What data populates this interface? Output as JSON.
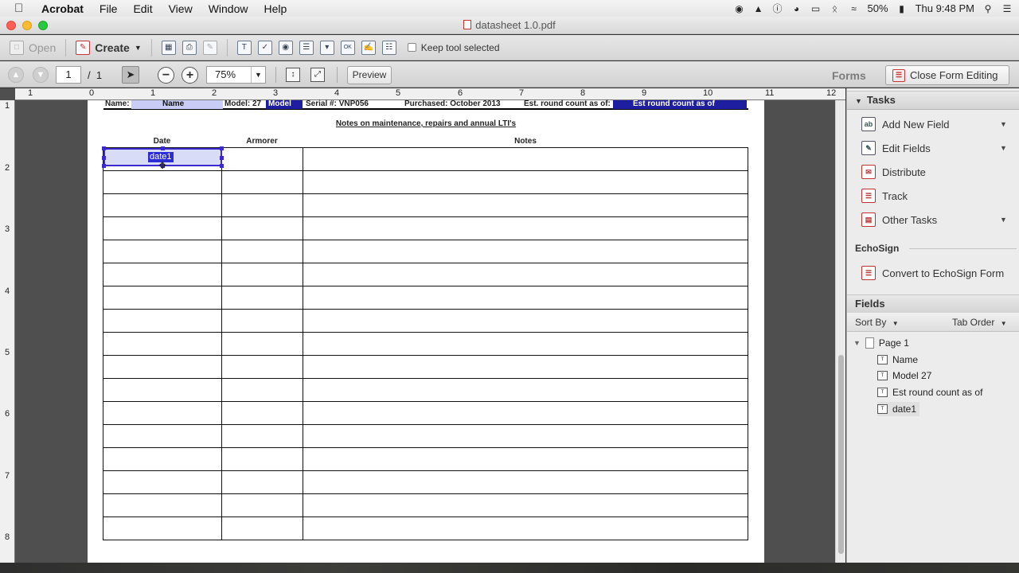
{
  "menubar": {
    "app_name": "Acrobat",
    "items": [
      "File",
      "Edit",
      "View",
      "Window",
      "Help"
    ],
    "battery": "50%",
    "clock": "Thu 9:48 PM"
  },
  "window": {
    "title": "datasheet 1.0.pdf"
  },
  "toolbar1": {
    "open_label": "Open",
    "create_label": "Create",
    "keep_tool_label": "Keep tool selected"
  },
  "toolbar2": {
    "page_current": "1",
    "page_total": "1",
    "zoom": "75%",
    "preview_label": "Preview",
    "forms_label": "Forms",
    "close_form_label": "Close Form Editing"
  },
  "ruler": {
    "h_numbers": [
      "1",
      "0",
      "1",
      "2",
      "3",
      "4",
      "5",
      "6",
      "7",
      "8",
      "9",
      "10",
      "11",
      "12"
    ],
    "v_numbers": [
      "1",
      "2",
      "3",
      "4",
      "5",
      "6",
      "7",
      "8"
    ]
  },
  "document": {
    "header": {
      "name_label": "Name:",
      "name_field": "Name",
      "model_label": "Model:  27",
      "model_field": "Model",
      "serial_label": "Serial #:  VNP056",
      "purchased_label": "Purchased:  October 2013",
      "est_label": "Est. round count as of:",
      "est_field": "Est round count as of"
    },
    "notes_title": "Notes on maintenance, repairs and annual LTI's",
    "columns": [
      "Date",
      "Armorer",
      "Notes"
    ],
    "row_count": 17,
    "selected_field": "date1"
  },
  "panel": {
    "tasks_title": "Tasks",
    "tasks": [
      {
        "label": "Add New Field",
        "has_dropdown": true
      },
      {
        "label": "Edit Fields",
        "has_dropdown": true
      },
      {
        "label": "Distribute",
        "has_dropdown": false
      },
      {
        "label": "Track",
        "has_dropdown": false
      },
      {
        "label": "Other Tasks",
        "has_dropdown": true
      }
    ],
    "echosign_title": "EchoSign",
    "echosign_convert": "Convert to EchoSign Form",
    "fields_title": "Fields",
    "sort_by": "Sort By",
    "tab_order": "Tab Order",
    "tree": {
      "page": "Page 1",
      "fields": [
        "Name",
        "Model  27",
        "Est round count as of",
        "date1"
      ]
    }
  }
}
